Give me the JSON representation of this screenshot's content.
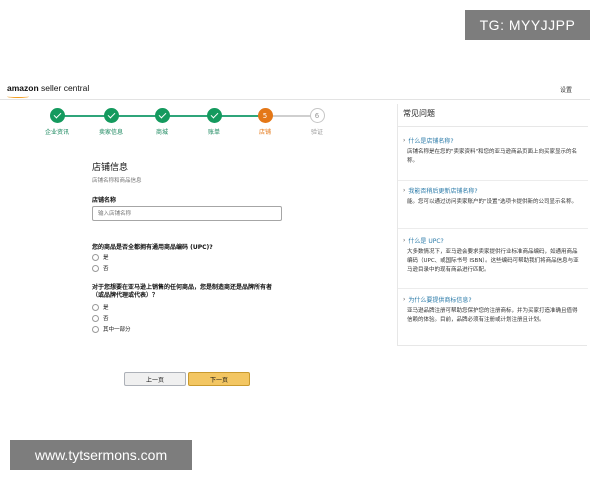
{
  "overlays": {
    "tg_badge": "TG: MYYJJPP",
    "url_badge": "www.tytsermons.com"
  },
  "header": {
    "logo_brand": "amazon",
    "logo_product": "seller central",
    "settings_label": "设置"
  },
  "stepper": {
    "steps": [
      {
        "label": "企业资讯",
        "state": "done",
        "number": ""
      },
      {
        "label": "卖家信息",
        "state": "done",
        "number": ""
      },
      {
        "label": "商城",
        "state": "done",
        "number": ""
      },
      {
        "label": "账单",
        "state": "done",
        "number": ""
      },
      {
        "label": "店铺",
        "state": "current",
        "number": "5"
      },
      {
        "label": "验证",
        "state": "todo",
        "number": "6"
      }
    ]
  },
  "form": {
    "title": "店铺信息",
    "subtitle": "店铺名称和商品信息",
    "store_name_label": "店铺名称",
    "store_name_placeholder": "输入店铺名称",
    "store_name_value": "",
    "upc_question": "您的商品是否全都拥有通用商品编码 (UPC)?",
    "upc_options": [
      "是",
      "否"
    ],
    "brand_question_line1": "对于您想要在亚马逊上销售的任何商品，您是制造商还是品牌所有者",
    "brand_question_line2": "（或品牌代理或代表）？",
    "brand_options": [
      "是",
      "否",
      "其中一部分"
    ],
    "prev_button": "上一页",
    "next_button": "下一页"
  },
  "faq": {
    "title": "常见问题",
    "items": [
      {
        "question": "什么是店铺名称?",
        "answer": "店铺名称是在您的\"卖家资料\"和您的亚马逊商品页面上向买家显示的名称。"
      },
      {
        "question": "我能否稍后更新店铺名称?",
        "answer": "能。您可以通过访问卖家账户的\"设置\"选项卡提供新的公司显示名称。"
      },
      {
        "question": "什么是 UPC?",
        "answer": "大多数情况下，亚马逊会要求卖家提供行业标准商品编码，如通用商品编码（UPC、或国际书号 ISBN）。这些编码可帮助我们将商品信息与亚马逊目录中的现有商品进行匹配。"
      },
      {
        "question": "为什么要提供商标信息?",
        "answer": "亚马逊品牌注册可帮助您保护您的注册商标，并为买家打造准确且值得信赖的体验。目前，品牌必须有注册或计划注册且计划。"
      }
    ]
  },
  "colors": {
    "step_done": "#149a5e",
    "step_current": "#e47717",
    "link": "#2a7aa8",
    "next_button": "#f3c662"
  }
}
